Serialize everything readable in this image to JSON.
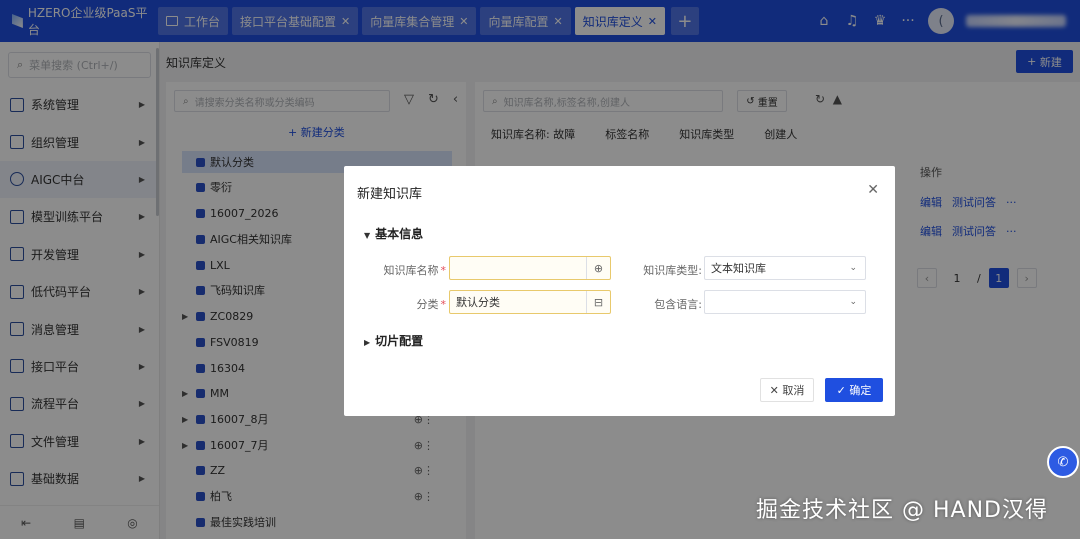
{
  "app": {
    "title": "HZERO企业级PaaS平台"
  },
  "tabs": [
    {
      "label": "工作台",
      "closable": false
    },
    {
      "label": "接口平台基础配置",
      "closable": true
    },
    {
      "label": "向量库集合管理",
      "closable": true
    },
    {
      "label": "向量库配置",
      "closable": true
    },
    {
      "label": "知识库定义",
      "closable": true,
      "active": true
    }
  ],
  "header_icons": [
    "home-icon",
    "bell-icon",
    "chef-hat-icon",
    "more-icon"
  ],
  "avatar_letter": "(",
  "sidebar": {
    "search_placeholder": "菜单搜索 (Ctrl+/)",
    "items": [
      {
        "label": "系统管理"
      },
      {
        "label": "组织管理"
      },
      {
        "label": "AIGC中台",
        "active": true
      },
      {
        "label": "模型训练平台"
      },
      {
        "label": "开发管理"
      },
      {
        "label": "低代码平台"
      },
      {
        "label": "消息管理"
      },
      {
        "label": "接口平台"
      },
      {
        "label": "流程平台"
      },
      {
        "label": "文件管理"
      },
      {
        "label": "基础数据"
      }
    ]
  },
  "page": {
    "title": "知识库定义",
    "new_button": "新建"
  },
  "tree": {
    "search_placeholder": "请搜索分类名称或分类编码",
    "add_label": "新建分类",
    "nodes": [
      {
        "label": "默认分类",
        "selected": true,
        "expandable": false
      },
      {
        "label": "零衍",
        "expandable": false
      },
      {
        "label": "16007_2026",
        "expandable": false
      },
      {
        "label": "AIGC相关知识库",
        "expandable": false
      },
      {
        "label": "LXL",
        "expandable": false
      },
      {
        "label": "飞码知识库",
        "expandable": false
      },
      {
        "label": "ZC0829",
        "expandable": true
      },
      {
        "label": "FSV0819",
        "expandable": false
      },
      {
        "label": "16304",
        "expandable": false
      },
      {
        "label": "MM",
        "expandable": true
      },
      {
        "label": "16007_8月",
        "expandable": true,
        "ops": true
      },
      {
        "label": "16007_7月",
        "expandable": true,
        "ops": true
      },
      {
        "label": "ZZ",
        "expandable": false,
        "ops": true
      },
      {
        "label": "柏飞",
        "expandable": false,
        "ops": true
      },
      {
        "label": "最佳实践培训",
        "expandable": false
      }
    ]
  },
  "main": {
    "search_placeholder": "知识库名称,标签名称,创建人",
    "reset_label": "重置",
    "filters": [
      "知识库名称: 故障",
      "标签名称",
      "知识库类型",
      "创建人"
    ],
    "ops_header": "操作",
    "row_actions": [
      "编辑",
      "测试问答",
      "···"
    ],
    "pager": {
      "current": "1",
      "separator": "/",
      "total": "1"
    }
  },
  "dialog": {
    "title": "新建知识库",
    "section_basic": "基本信息",
    "section_chunk": "切片配置",
    "fields": {
      "name_label": "知识库名称",
      "name_value": "",
      "category_label": "分类",
      "category_value": "默认分类",
      "type_label": "知识库类型",
      "type_value": "文本知识库",
      "lang_label": "包含语言",
      "lang_value": ""
    },
    "cancel_label": "取消",
    "ok_label": "确定"
  },
  "watermark": "掘金技术社区 @ HAND汉得"
}
